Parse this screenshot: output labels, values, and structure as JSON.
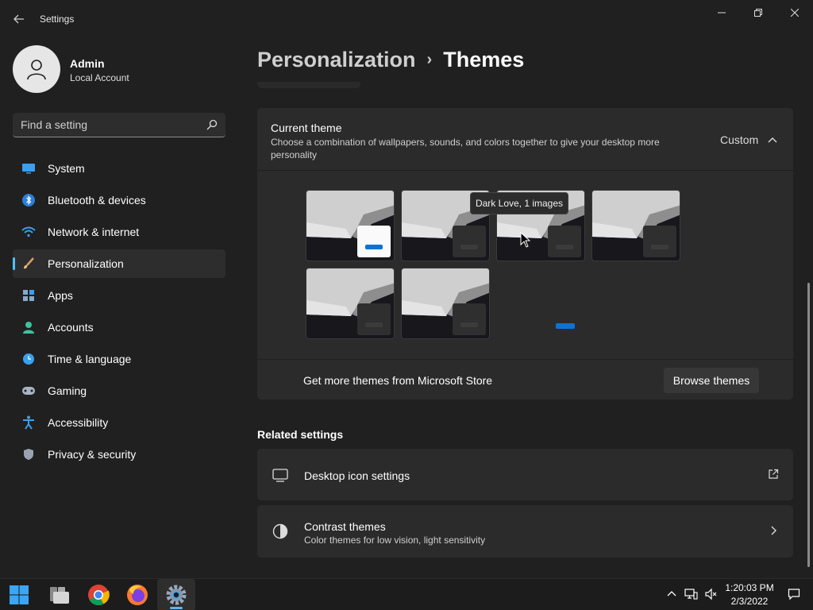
{
  "window": {
    "title": "Settings",
    "controls": {
      "minimize": "minimize-icon",
      "maximize": "restore-icon",
      "close": "close-icon"
    }
  },
  "user": {
    "name": "Admin",
    "account_type": "Local Account"
  },
  "search": {
    "placeholder": "Find a setting"
  },
  "nav": {
    "items": [
      {
        "label": "System",
        "icon": "system-icon"
      },
      {
        "label": "Bluetooth & devices",
        "icon": "bluetooth-icon"
      },
      {
        "label": "Network & internet",
        "icon": "network-icon"
      },
      {
        "label": "Personalization",
        "icon": "brush-icon",
        "active": true
      },
      {
        "label": "Apps",
        "icon": "apps-icon"
      },
      {
        "label": "Accounts",
        "icon": "accounts-icon"
      },
      {
        "label": "Time & language",
        "icon": "time-icon"
      },
      {
        "label": "Gaming",
        "icon": "gaming-icon"
      },
      {
        "label": "Accessibility",
        "icon": "accessibility-icon"
      },
      {
        "label": "Privacy & security",
        "icon": "shield-icon"
      }
    ]
  },
  "breadcrumb": {
    "parent": "Personalization",
    "separator": "›",
    "current": "Themes"
  },
  "current_theme": {
    "title": "Current theme",
    "description": "Choose a combination of wallpapers, sounds, and colors together to give your desktop more personality",
    "value": "Custom",
    "tooltip": "Dark Love, 1 images",
    "thumbnails": [
      {
        "style": "light"
      },
      {
        "style": "dark"
      },
      {
        "style": "dark"
      },
      {
        "style": "dark"
      },
      {
        "style": "dark"
      },
      {
        "style": "dark"
      }
    ]
  },
  "store": {
    "label": "Get more themes from Microsoft Store",
    "button": "Browse themes"
  },
  "related": {
    "title": "Related settings",
    "desktop_icons": {
      "title": "Desktop icon settings",
      "icon": "desktop-icon",
      "end_icon": "external-link-icon"
    },
    "contrast": {
      "title": "Contrast themes",
      "subtitle": "Color themes for low vision, light sensitivity",
      "icon": "contrast-icon",
      "end_icon": "chevron-right-icon"
    }
  },
  "taskbar": {
    "apps": [
      "start-icon",
      "file-explorer-icon",
      "chrome-icon",
      "firefox-icon",
      "settings-icon"
    ],
    "tray": [
      "chevron-up-icon",
      "network-icon",
      "volume-muted-icon",
      "notification-icon"
    ],
    "time": "1:20:03 PM",
    "date": "2/3/2022"
  },
  "colors": {
    "accent": "#4cc2ff",
    "window_bg": "#202020",
    "card_bg": "#2b2b2b",
    "theme_blue": "#0a74d6"
  }
}
